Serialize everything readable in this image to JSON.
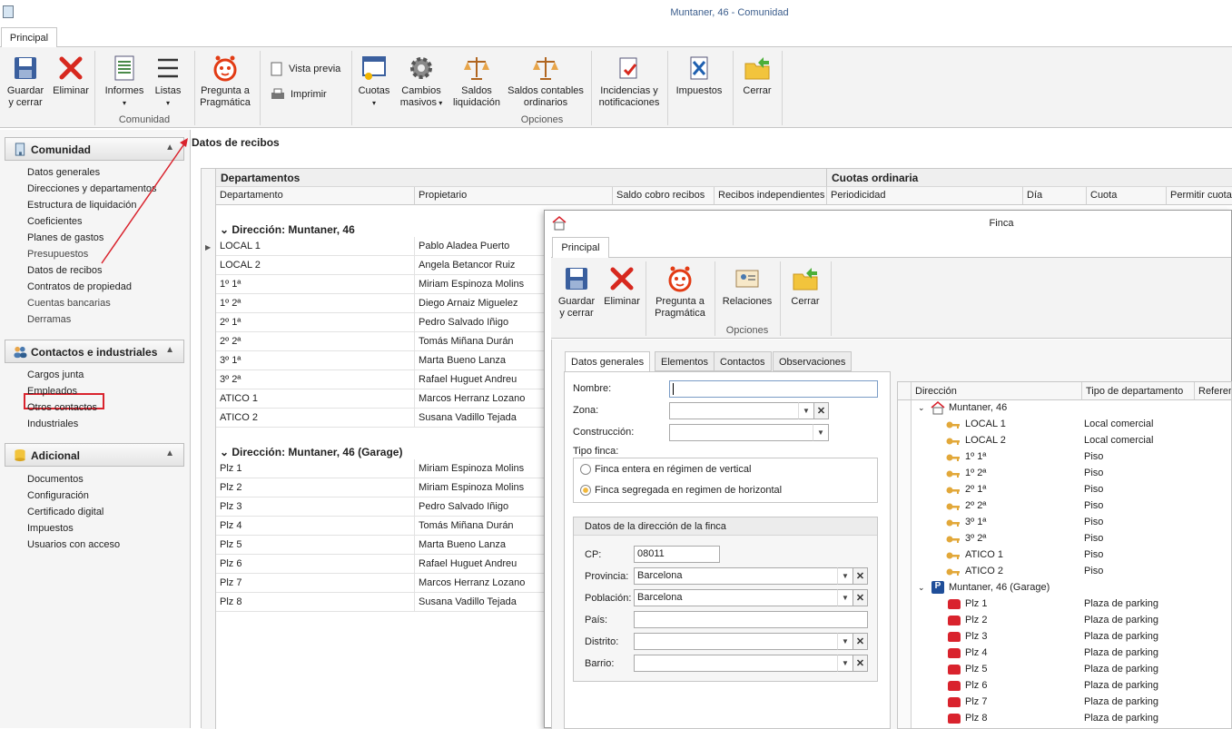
{
  "window": {
    "title": "Muntaner, 46 - Comunidad"
  },
  "ribbon": {
    "tab": "Principal",
    "buttons": {
      "guardar": "Guardar\ny cerrar",
      "eliminar": "Eliminar",
      "informes": "Informes",
      "listas": "Listas",
      "pregunta": "Pregunta a\nPragmática",
      "vista": "Vista previa",
      "imprimir": "Imprimir",
      "cuotas": "Cuotas",
      "cambios": "Cambios\nmasivos",
      "saldos_liq": "Saldos\nliquidación",
      "saldos_cont": "Saldos contables\nordinarios",
      "incidencias": "Incidencias y\nnotificaciones",
      "impuestos": "Impuestos",
      "cerrar": "Cerrar"
    },
    "groups": {
      "comunidad": "Comunidad",
      "opciones": "Opciones"
    }
  },
  "sidebar": {
    "sections": [
      {
        "title": "Comunidad",
        "items": [
          "Datos generales",
          "Direcciones y departamentos",
          "Estructura de liquidación",
          "Coeficientes",
          "Planes de gastos",
          "Presupuestos",
          "Datos de recibos",
          "Contratos de propiedad",
          "Cuentas bancarias",
          "Derramas"
        ]
      },
      {
        "title": "Contactos e industriales",
        "items": [
          "Cargos junta",
          "Empleados",
          "Otros contactos",
          "Industriales"
        ]
      },
      {
        "title": "Adicional",
        "items": [
          "Documentos",
          "Configuración",
          "Certificado digital",
          "Impuestos",
          "Usuarios con acceso"
        ]
      }
    ],
    "selected": "Datos de recibos"
  },
  "content": {
    "title": "Datos de recibos",
    "band1": "Departamentos",
    "band2": "Cuotas ordinaria",
    "columns": [
      "Departamento",
      "Propietario",
      "Saldo cobro recibos",
      "Recibos independientes",
      "Periodicidad",
      "Día",
      "Cuota",
      "Permitir cuota"
    ],
    "groups": [
      {
        "header": "Dirección: Muntaner, 46",
        "rows": [
          [
            "LOCAL 1",
            "Pablo Aladea Puerto"
          ],
          [
            "LOCAL 2",
            "Angela Betancor Ruiz"
          ],
          [
            "1º 1ª",
            "Miriam Espinoza Molins"
          ],
          [
            "1º 2ª",
            "Diego Arnaiz Miguelez"
          ],
          [
            "2º 1ª",
            "Pedro Salvado Iñigo"
          ],
          [
            "2º 2ª",
            "Tomás Miñana Durán"
          ],
          [
            "3º 1ª",
            "Marta Bueno Lanza"
          ],
          [
            "3º 2ª",
            "Rafael Huguet Andreu"
          ],
          [
            "ATICO 1",
            "Marcos Herranz Lozano"
          ],
          [
            "ATICO 2",
            "Susana Vadillo Tejada"
          ]
        ]
      },
      {
        "header": "Dirección: Muntaner, 46 (Garage)",
        "rows": [
          [
            "Plz 1",
            "Miriam Espinoza Molins"
          ],
          [
            "Plz 2",
            "Miriam Espinoza Molins"
          ],
          [
            "Plz 3",
            "Pedro Salvado Iñigo"
          ],
          [
            "Plz 4",
            "Tomás Miñana Durán"
          ],
          [
            "Plz 5",
            "Marta Bueno Lanza"
          ],
          [
            "Plz 6",
            "Rafael Huguet Andreu"
          ],
          [
            "Plz 7",
            "Marcos Herranz Lozano"
          ],
          [
            "Plz 8",
            "Susana Vadillo Tejada"
          ]
        ]
      }
    ]
  },
  "finca": {
    "title": "Finca",
    "tab": "Principal",
    "buttons": {
      "guardar": "Guardar\ny cerrar",
      "eliminar": "Eliminar",
      "pregunta": "Pregunta a\nPragmática",
      "relaciones": "Relaciones",
      "cerrar": "Cerrar"
    },
    "group": "Opciones",
    "tabs": [
      "Datos generales",
      "Elementos",
      "Contactos",
      "Observaciones"
    ],
    "form": {
      "nombre_label": "Nombre:",
      "nombre": "",
      "zona_label": "Zona:",
      "construccion_label": "Construcción:",
      "tipo_label": "Tipo finca:",
      "radio1": "Finca entera en régimen de vertical",
      "radio2": "Finca segregada en regimen de horizontal",
      "dir_group": "Datos de la dirección de la finca",
      "cp_label": "CP:",
      "cp": "08011",
      "provincia_label": "Provincia:",
      "provincia": "Barcelona",
      "poblacion_label": "Población:",
      "poblacion": "Barcelona",
      "pais_label": "País:",
      "distrito_label": "Distrito:",
      "barrio_label": "Barrio:"
    },
    "tree": {
      "columns": [
        "Dirección",
        "Tipo de departamento",
        "Referencia"
      ],
      "nodes": [
        {
          "name": "Muntaner, 46",
          "children": [
            [
              "LOCAL 1",
              "Local comercial"
            ],
            [
              "LOCAL 2",
              "Local comercial"
            ],
            [
              "1º 1ª",
              "Piso"
            ],
            [
              "1º 2ª",
              "Piso"
            ],
            [
              "2º 1ª",
              "Piso"
            ],
            [
              "2º 2ª",
              "Piso"
            ],
            [
              "3º 1ª",
              "Piso"
            ],
            [
              "3º 2ª",
              "Piso"
            ],
            [
              "ATICO 1",
              "Piso"
            ],
            [
              "ATICO 2",
              "Piso"
            ]
          ]
        },
        {
          "name": "Muntaner, 46 (Garage)",
          "children": [
            [
              "Plz 1",
              "Plaza de parking"
            ],
            [
              "Plz 2",
              "Plaza de parking"
            ],
            [
              "Plz 3",
              "Plaza de parking"
            ],
            [
              "Plz 4",
              "Plaza de parking"
            ],
            [
              "Plz 5",
              "Plaza de parking"
            ],
            [
              "Plz 6",
              "Plaza de parking"
            ],
            [
              "Plz 7",
              "Plaza de parking"
            ],
            [
              "Plz 8",
              "Plaza de parking"
            ]
          ]
        }
      ]
    }
  }
}
